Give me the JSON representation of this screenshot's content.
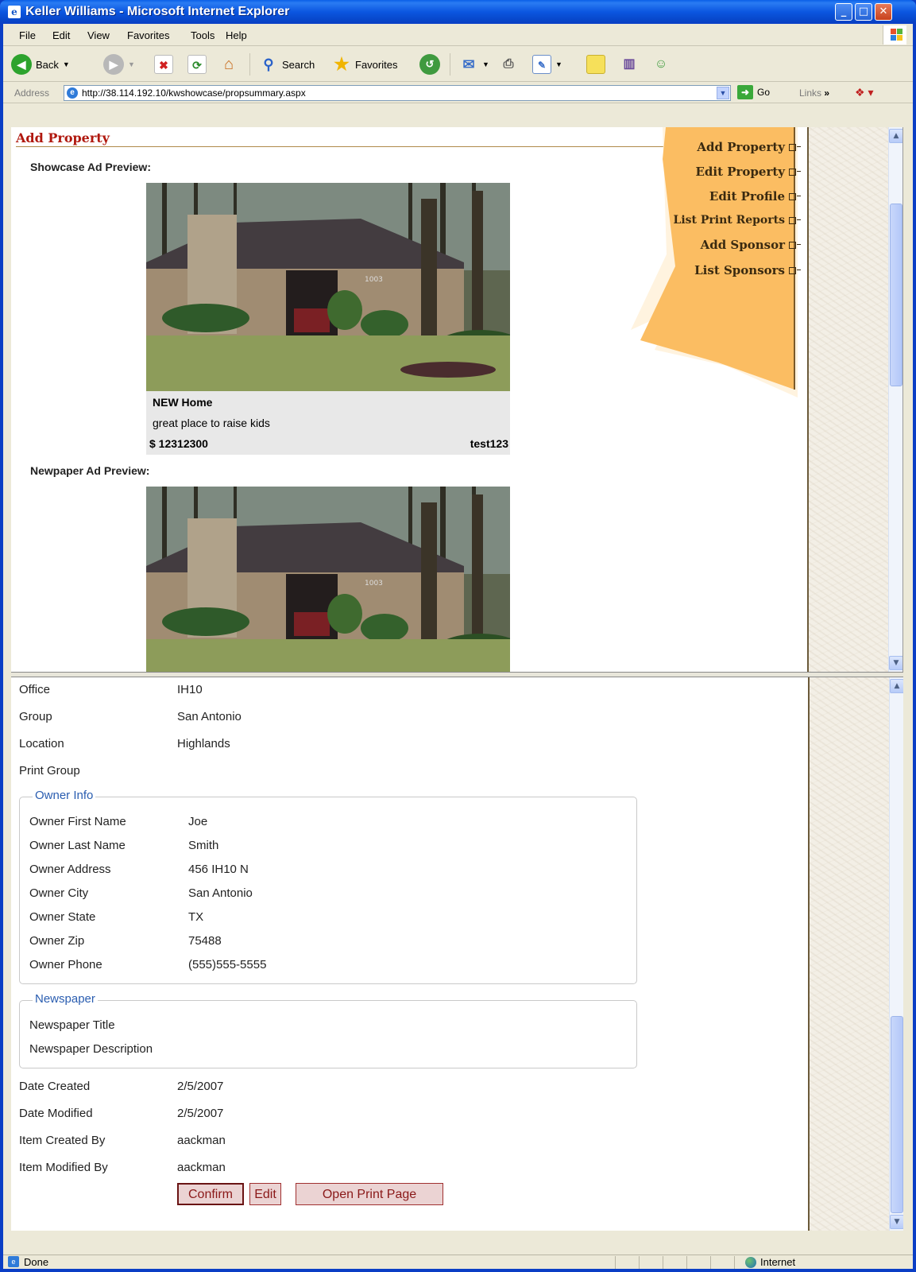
{
  "window": {
    "title": "Keller Williams - Microsoft Internet Explorer",
    "controls": {
      "minimize": "_",
      "maximize": "□",
      "close": "✕"
    }
  },
  "menubar": {
    "items": [
      "File",
      "Edit",
      "View",
      "Favorites",
      "Tools",
      "Help"
    ]
  },
  "toolbar": {
    "back_label": "Back",
    "search_label": "Search",
    "favorites_label": "Favorites"
  },
  "addressbar": {
    "label": "Address",
    "url": "http://38.114.192.10/kwshowcase/propsummary.aspx",
    "go_label": "Go",
    "links_label": "Links"
  },
  "page": {
    "title": "Add Property",
    "showcase_label": "Showcase Ad Preview:",
    "newspaper_label": "Newpaper Ad Preview:"
  },
  "nav": {
    "items": [
      "Add Property",
      "Edit Property",
      "Edit Profile",
      "List Print Reports",
      "Add Sponsor",
      "List Sponsors"
    ]
  },
  "ad": {
    "headline": "NEW Home",
    "description": "great place to raise kids",
    "price": "$ 12312300",
    "code": "test123",
    "house_number": "1003"
  },
  "details": {
    "office": {
      "label": "Office",
      "value": "IH10"
    },
    "group": {
      "label": "Group",
      "value": "San Antonio"
    },
    "location": {
      "label": "Location",
      "value": "Highlands"
    },
    "print_group": {
      "label": "Print Group",
      "value": ""
    },
    "owner_legend": "Owner Info",
    "owner": {
      "first_name": {
        "label": "Owner First Name",
        "value": "Joe"
      },
      "last_name": {
        "label": "Owner Last Name",
        "value": "Smith"
      },
      "address": {
        "label": "Owner Address",
        "value": "456 IH10 N"
      },
      "city": {
        "label": "Owner City",
        "value": "San Antonio"
      },
      "state": {
        "label": "Owner State",
        "value": "TX"
      },
      "zip": {
        "label": "Owner Zip",
        "value": "75488"
      },
      "phone": {
        "label": "Owner Phone",
        "value": "(555)555-5555"
      }
    },
    "newspaper_legend": "Newspaper",
    "newspaper": {
      "title": {
        "label": "Newspaper Title",
        "value": ""
      },
      "description": {
        "label": "Newspaper Description",
        "value": ""
      }
    },
    "date_created": {
      "label": "Date Created",
      "value": "2/5/2007"
    },
    "date_modified": {
      "label": "Date Modified",
      "value": "2/5/2007"
    },
    "created_by": {
      "label": "Item Created By",
      "value": "aackman"
    },
    "modified_by": {
      "label": "Item Modified By",
      "value": "aackman"
    }
  },
  "buttons": {
    "confirm": "Confirm",
    "edit": "Edit",
    "open_print": "Open Print Page"
  },
  "status": {
    "text": "Done",
    "zone": "Internet"
  },
  "colors": {
    "title_red": "#b0180e",
    "nav_orange": "#fbbd62",
    "xp_blue": "#0a3ec5",
    "legend_blue": "#2a5db0"
  }
}
